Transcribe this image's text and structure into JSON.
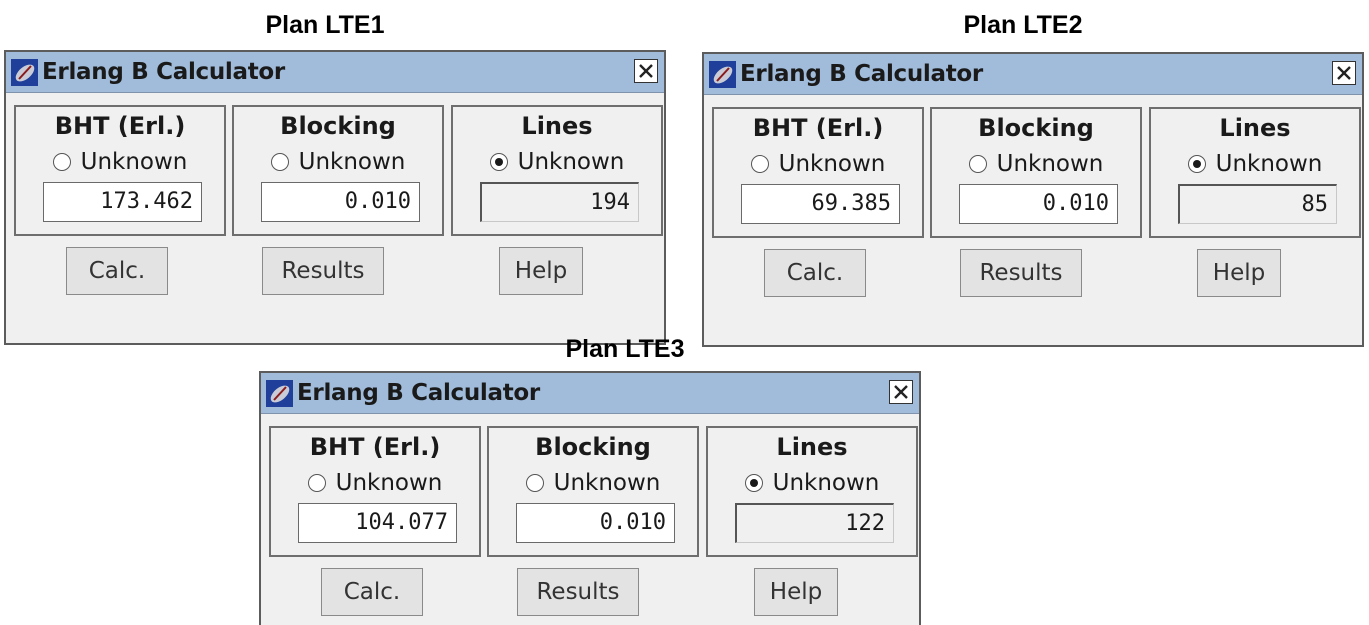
{
  "windows": [
    {
      "plan_label": "Plan LTE1",
      "title": "Erlang B Calculator",
      "panels": [
        {
          "heading": "BHT (Erl.)",
          "radio_label": "Unknown",
          "selected": false,
          "value": "173.462"
        },
        {
          "heading": "Blocking",
          "radio_label": "Unknown",
          "selected": false,
          "value": "0.010"
        },
        {
          "heading": "Lines",
          "radio_label": "Unknown",
          "selected": true,
          "value": "194"
        }
      ],
      "buttons": [
        "Calc.",
        "Results",
        "Help"
      ]
    },
    {
      "plan_label": "Plan LTE2",
      "title": "Erlang B Calculator",
      "panels": [
        {
          "heading": "BHT (Erl.)",
          "radio_label": "Unknown",
          "selected": false,
          "value": "69.385"
        },
        {
          "heading": "Blocking",
          "radio_label": "Unknown",
          "selected": false,
          "value": "0.010"
        },
        {
          "heading": "Lines",
          "radio_label": "Unknown",
          "selected": true,
          "value": "85"
        }
      ],
      "buttons": [
        "Calc.",
        "Results",
        "Help"
      ]
    },
    {
      "plan_label": "Plan LTE3",
      "title": "Erlang B Calculator",
      "panels": [
        {
          "heading": "BHT (Erl.)",
          "radio_label": "Unknown",
          "selected": false,
          "value": "104.077"
        },
        {
          "heading": "Blocking",
          "radio_label": "Unknown",
          "selected": false,
          "value": "0.010"
        },
        {
          "heading": "Lines",
          "radio_label": "Unknown",
          "selected": true,
          "value": "122"
        }
      ],
      "buttons": [
        "Calc.",
        "Results",
        "Help"
      ]
    }
  ],
  "icons": {
    "app": "satellite-dish-icon",
    "close": "close-icon"
  },
  "colors": {
    "titlebar": "#a0bcda",
    "window_bg": "#f0f0f0",
    "field_bg": "#ffffff"
  }
}
